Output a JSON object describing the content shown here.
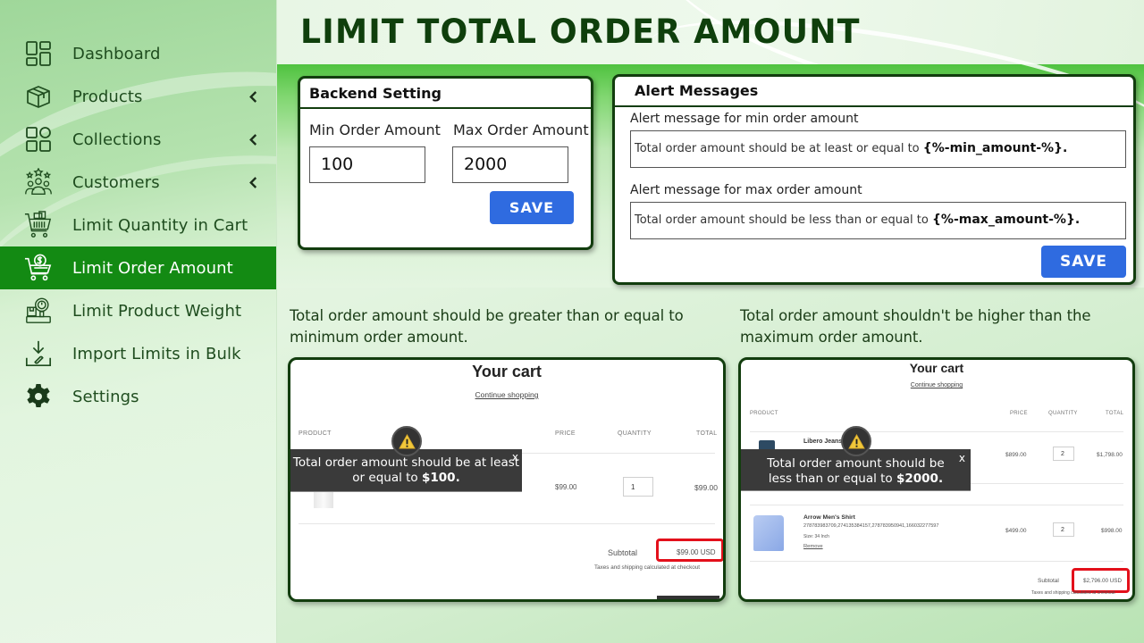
{
  "sidebar": {
    "items": [
      {
        "label": "Dashboard",
        "icon": "dashboard-icon",
        "has_chevron": false,
        "active": false
      },
      {
        "label": "Products",
        "icon": "box-icon",
        "has_chevron": true,
        "active": false
      },
      {
        "label": "Collections",
        "icon": "collections-icon",
        "has_chevron": true,
        "active": false
      },
      {
        "label": "Customers",
        "icon": "customers-icon",
        "has_chevron": true,
        "active": false
      },
      {
        "label": "Limit Quantity in Cart",
        "icon": "cart-icon",
        "has_chevron": false,
        "active": false
      },
      {
        "label": "Limit Order Amount",
        "icon": "cart-dollar-icon",
        "has_chevron": false,
        "active": true
      },
      {
        "label": "Limit Product Weight",
        "icon": "weight-scale-icon",
        "has_chevron": false,
        "active": false
      },
      {
        "label": "Import Limits in Bulk",
        "icon": "import-icon",
        "has_chevron": false,
        "active": false
      },
      {
        "label": "Settings",
        "icon": "gear-icon",
        "has_chevron": false,
        "active": false
      }
    ],
    "active_color": "#138a13",
    "text_color": "#1f4d1f"
  },
  "header": {
    "title": "LIMIT TOTAL ORDER AMOUNT",
    "title_color": "#0f3f0c"
  },
  "backend_setting": {
    "title": "Backend Setting",
    "min_label": "Min Order Amount",
    "min_value": "100",
    "max_label": "Max Order Amount",
    "max_value": "2000",
    "save_label": "SAVE"
  },
  "alert_messages": {
    "title": "Alert Messages",
    "min_label": "Alert message for min order amount",
    "min_text": "Total order amount should be at least or equal to ",
    "min_placeholder_token": "{%-min_amount-%}.",
    "max_label": "Alert message for max order amount",
    "max_text": "Total order amount should be less than or equal to ",
    "max_placeholder_token": "{%-max_amount-%}.",
    "save_label": "SAVE",
    "button_color": "#2f6be0"
  },
  "captions": {
    "min": "Total order amount should be greater than or equal to minimum order amount.",
    "max": "Total order amount shouldn't be higher than the maximum order amount."
  },
  "cart_min": {
    "title": "Your cart",
    "continue": "Continue shopping",
    "columns": [
      "PRODUCT",
      "PRICE",
      "QUANTITY",
      "TOTAL"
    ],
    "row": {
      "price": "$99.00",
      "quantity": "1",
      "total": "$99.00"
    },
    "subtotal_label": "Subtotal",
    "subtotal_value": "$99.00 USD",
    "tax_note": "Taxes and shipping calculated at checkout",
    "toast_text": "Total order amount should be at least or equal to ",
    "toast_amount": "$100.",
    "toast_close": "x"
  },
  "cart_max": {
    "title": "Your cart",
    "continue": "Continue shopping",
    "columns": [
      "PRODUCT",
      "PRICE",
      "QUANTITY",
      "TOTAL"
    ],
    "rows": [
      {
        "name": "Libero Jeans",
        "price": "$899.00",
        "quantity": "2",
        "total": "$1,798.00"
      },
      {
        "name": "Arrow Men's Shirt",
        "ids": "278783983709,274135384157,278783950941,166032277597",
        "size": "Size: 34 Inch",
        "remove": "Remove",
        "price": "$499.00",
        "quantity": "2",
        "total": "$998.00"
      }
    ],
    "subtotal_label": "Subtotal",
    "subtotal_value": "$2,796.00 USD",
    "tax_note": "Taxes and shipping calculated at checkout",
    "toast_text": "Total order amount should be less than or equal to ",
    "toast_amount": "$2000.",
    "toast_close": "x"
  },
  "highlight_color": "#e3101b"
}
